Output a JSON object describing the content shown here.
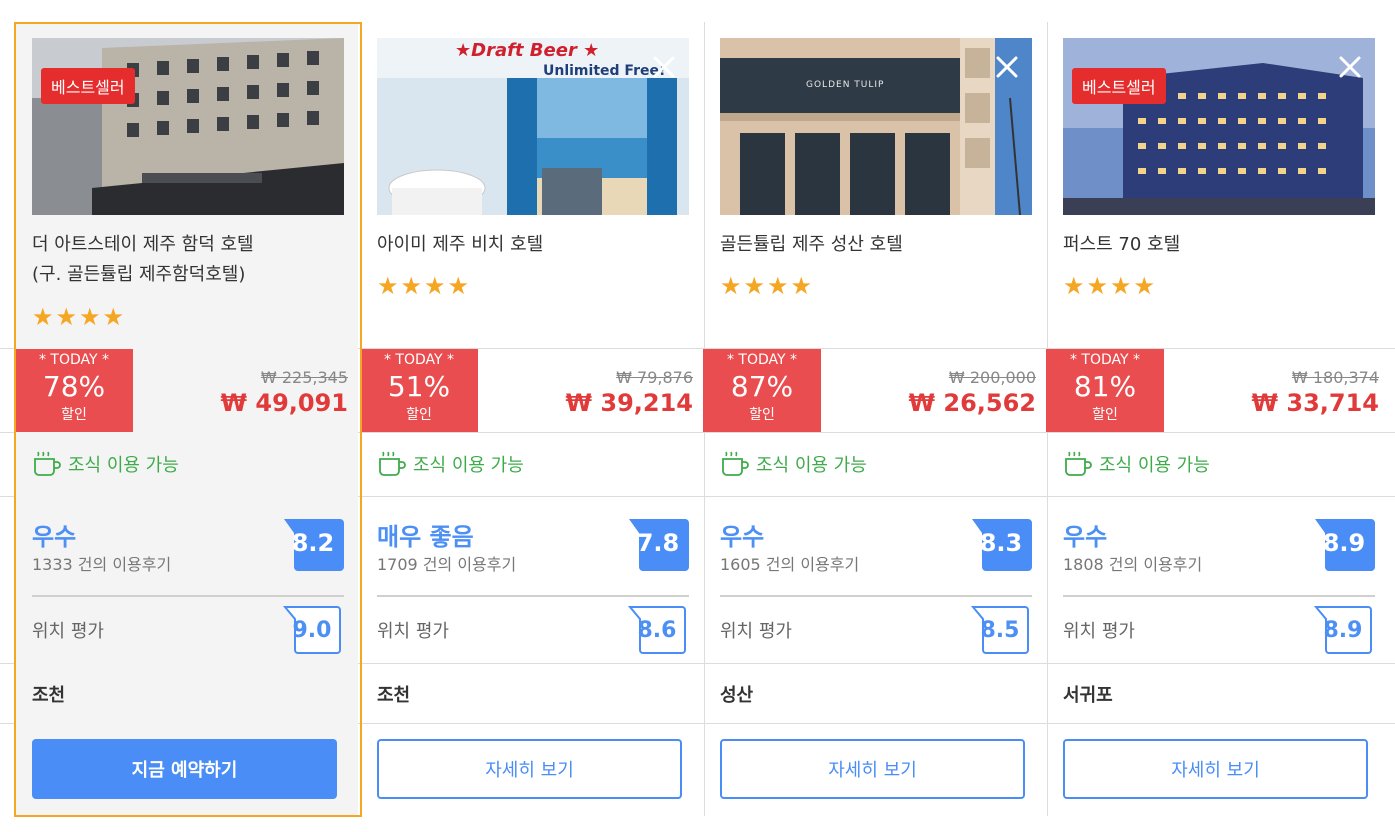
{
  "hotels": [
    {
      "name_line1": "더 아트스테이 제주 함덕 호텔",
      "name_line2": "(구. 골든튤립 제주함덕호텔)",
      "bestseller": "베스트셀러",
      "stars": "★★★★",
      "today_label": "* TODAY *",
      "discount": "78%",
      "discount_sub": "할인",
      "old_price": "₩ 225,345",
      "new_price": "₩ 49,091",
      "breakfast": "조식 이용 가능",
      "rating_word": "우수",
      "review_count": "1333 건의 이용후기",
      "score": "8.2",
      "location_label": "위치 평가",
      "location_score": "9.0",
      "area": "조천",
      "button": "지금 예약하기"
    },
    {
      "name_line1": "아이미 제주 비치 호텔",
      "name_line2": "",
      "stars": "★★★★",
      "photo_text1": "★Draft Beer ★",
      "photo_text2": "Unlimited Free!",
      "today_label": "* TODAY *",
      "discount": "51%",
      "discount_sub": "할인",
      "old_price": "₩ 79,876",
      "new_price": "₩ 39,214",
      "breakfast": "조식 이용 가능",
      "rating_word": "매우 좋음",
      "review_count": "1709 건의 이용후기",
      "score": "7.8",
      "location_label": "위치 평가",
      "location_score": "8.6",
      "area": "조천",
      "button": "자세히 보기"
    },
    {
      "name_line1": "골든튤립 제주 성산 호텔",
      "name_line2": "",
      "stars": "★★★★",
      "photo_sign": "GOLDEN TULIP",
      "today_label": "* TODAY *",
      "discount": "87%",
      "discount_sub": "할인",
      "old_price": "₩ 200,000",
      "new_price": "₩ 26,562",
      "breakfast": "조식 이용 가능",
      "rating_word": "우수",
      "review_count": "1605 건의 이용후기",
      "score": "8.3",
      "location_label": "위치 평가",
      "location_score": "8.5",
      "area": "성산",
      "button": "자세히 보기"
    },
    {
      "name_line1": "퍼스트 70 호텔",
      "name_line2": "",
      "bestseller": "베스트셀러",
      "stars": "★★★★",
      "today_label": "* TODAY *",
      "discount": "81%",
      "discount_sub": "할인",
      "old_price": "₩ 180,374",
      "new_price": "₩ 33,714",
      "breakfast": "조식 이용 가능",
      "rating_word": "우수",
      "review_count": "1808 건의 이용후기",
      "score": "8.9",
      "location_label": "위치 평가",
      "location_score": "8.9",
      "area": "서귀포",
      "button": "자세히 보기"
    }
  ],
  "colors": {
    "accent_blue": "#4a8df6",
    "discount_red": "#ea4d4f",
    "price_red": "#e03a3a",
    "bestseller_red": "#e52d2d",
    "star_orange": "#f5a623",
    "breakfast_green": "#3eab4a",
    "selected_border": "#f5a623"
  },
  "icons": {
    "close": "close-icon",
    "breakfast": "coffee-cup-icon",
    "star": "star-icon"
  }
}
